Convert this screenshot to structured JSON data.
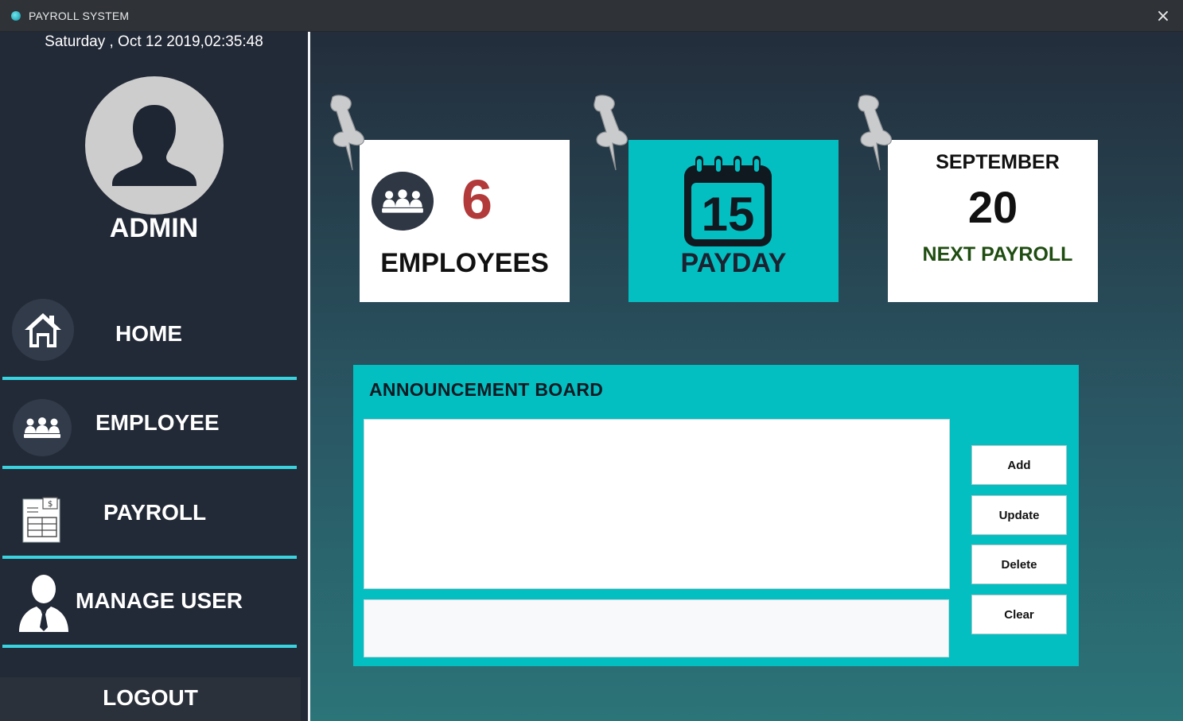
{
  "window": {
    "title": "PAYROLL SYSTEM",
    "close_icon": "×"
  },
  "sidebar": {
    "datetime": "Saturday , Oct 12 2019,02:35:48",
    "user": "ADMIN",
    "items": [
      {
        "label": "HOME",
        "icon": "home-icon"
      },
      {
        "label": "EMPLOYEE",
        "icon": "group-icon"
      },
      {
        "label": "PAYROLL",
        "icon": "payroll-sheet-icon"
      },
      {
        "label": "MANAGE USER",
        "icon": "user-tie-icon"
      }
    ],
    "logout": "LOGOUT",
    "accent": "#39d3df"
  },
  "cards": {
    "employees": {
      "count": "6",
      "label": "EMPLOYEES",
      "count_color": "#b23a3a"
    },
    "payday": {
      "day": "15",
      "label": "PAYDAY",
      "bg": "#03bfc2"
    },
    "next_payroll": {
      "month": "SEPTEMBER",
      "day": "20",
      "label": "NEXT PAYROLL",
      "label_color": "#1f4d11"
    }
  },
  "board": {
    "title": "ANNOUNCEMENT BOARD",
    "textarea_value": "",
    "input_value": "",
    "buttons": {
      "add": "Add",
      "update": "Update",
      "delete": "Delete",
      "clear": "Clear"
    },
    "bg": "#03bfc2"
  }
}
